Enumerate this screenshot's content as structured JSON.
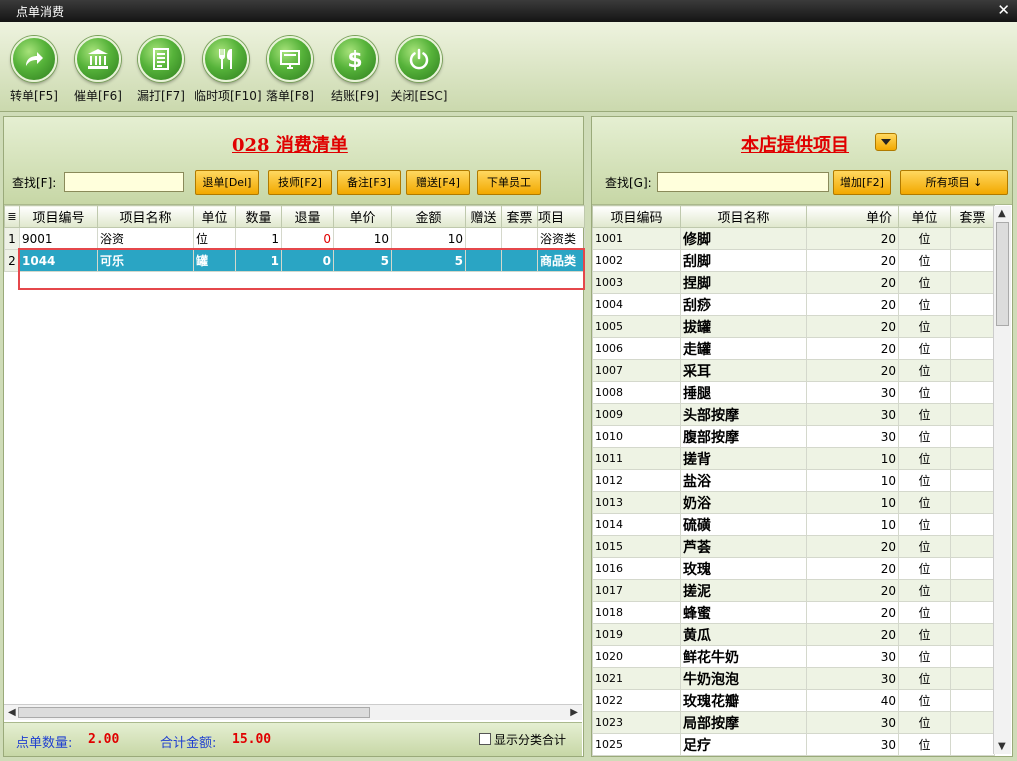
{
  "window": {
    "title": "点单消费",
    "close_glyph": "✕"
  },
  "toolbar": [
    {
      "name": "transfer",
      "label": "转单[F5]",
      "icon": "arrow-redo-icon"
    },
    {
      "name": "urge",
      "label": "催单[F6]",
      "icon": "bank-icon"
    },
    {
      "name": "reprint",
      "label": "漏打[F7]",
      "icon": "document-icon"
    },
    {
      "name": "temp-item",
      "label": "临时项[F10]",
      "icon": "utensils-icon"
    },
    {
      "name": "place-order",
      "label": "落单[F8]",
      "icon": "monitor-icon"
    },
    {
      "name": "checkout",
      "label": "结账[F9]",
      "icon": "dollar-icon"
    },
    {
      "name": "close",
      "label": "关闭[ESC]",
      "icon": "power-icon"
    }
  ],
  "left": {
    "title": "028 消费清单",
    "search_label": "查找[F]:",
    "search_value": "",
    "buttons": [
      "退单[Del]",
      "技师[F2]",
      "备注[F3]",
      "赠送[F4]",
      "下单员工"
    ],
    "columns": [
      "项目编号",
      "项目名称",
      "单位",
      "数量",
      "退量",
      "单价",
      "金额",
      "赠送",
      "套票",
      "项目"
    ],
    "rows": [
      {
        "idx": "1",
        "code": "9001",
        "name": "浴资",
        "unit": "位",
        "qty": "1",
        "ret": "0",
        "price": "10",
        "amount": "10",
        "gift": "",
        "ticket": "",
        "category": "浴资类"
      },
      {
        "idx": "2",
        "code": "1044",
        "name": "可乐",
        "unit": "罐",
        "qty": "1",
        "ret": "0",
        "price": "5",
        "amount": "5",
        "gift": "",
        "ticket": "",
        "category": "商品类"
      }
    ]
  },
  "footer": {
    "count_label": "点单数量:",
    "count_value": "2.00",
    "total_label": "合计金额:",
    "total_value": "15.00",
    "checkbox_label": "显示分类合计"
  },
  "right": {
    "title": "本店提供项目",
    "search_label": "查找[G]:",
    "search_value": "",
    "add_button": "增加[F2]",
    "all_button": "所有项目 ↓",
    "columns": [
      "项目编码",
      "项目名称",
      "单价",
      "单位",
      "套票"
    ],
    "rows": [
      {
        "code": "1001",
        "name": "修脚",
        "price": "20",
        "unit": "位",
        "ticket": ""
      },
      {
        "code": "1002",
        "name": "刮脚",
        "price": "20",
        "unit": "位",
        "ticket": ""
      },
      {
        "code": "1003",
        "name": "捏脚",
        "price": "20",
        "unit": "位",
        "ticket": ""
      },
      {
        "code": "1004",
        "name": "刮痧",
        "price": "20",
        "unit": "位",
        "ticket": ""
      },
      {
        "code": "1005",
        "name": "拔罐",
        "price": "20",
        "unit": "位",
        "ticket": ""
      },
      {
        "code": "1006",
        "name": "走罐",
        "price": "20",
        "unit": "位",
        "ticket": ""
      },
      {
        "code": "1007",
        "name": "采耳",
        "price": "20",
        "unit": "位",
        "ticket": ""
      },
      {
        "code": "1008",
        "name": "捶腿",
        "price": "30",
        "unit": "位",
        "ticket": ""
      },
      {
        "code": "1009",
        "name": "头部按摩",
        "price": "30",
        "unit": "位",
        "ticket": ""
      },
      {
        "code": "1010",
        "name": "腹部按摩",
        "price": "30",
        "unit": "位",
        "ticket": ""
      },
      {
        "code": "1011",
        "name": "搓背",
        "price": "10",
        "unit": "位",
        "ticket": ""
      },
      {
        "code": "1012",
        "name": "盐浴",
        "price": "10",
        "unit": "位",
        "ticket": ""
      },
      {
        "code": "1013",
        "name": "奶浴",
        "price": "10",
        "unit": "位",
        "ticket": ""
      },
      {
        "code": "1014",
        "name": "硫磺",
        "price": "10",
        "unit": "位",
        "ticket": ""
      },
      {
        "code": "1015",
        "name": "芦荟",
        "price": "20",
        "unit": "位",
        "ticket": ""
      },
      {
        "code": "1016",
        "name": "玫瑰",
        "price": "20",
        "unit": "位",
        "ticket": ""
      },
      {
        "code": "1017",
        "name": "搓泥",
        "price": "20",
        "unit": "位",
        "ticket": ""
      },
      {
        "code": "1018",
        "name": "蜂蜜",
        "price": "20",
        "unit": "位",
        "ticket": ""
      },
      {
        "code": "1019",
        "name": "黄瓜",
        "price": "20",
        "unit": "位",
        "ticket": ""
      },
      {
        "code": "1020",
        "name": "鲜花牛奶",
        "price": "30",
        "unit": "位",
        "ticket": ""
      },
      {
        "code": "1021",
        "name": "牛奶泡泡",
        "price": "30",
        "unit": "位",
        "ticket": ""
      },
      {
        "code": "1022",
        "name": "玫瑰花瓣",
        "price": "40",
        "unit": "位",
        "ticket": ""
      },
      {
        "code": "1023",
        "name": "局部按摩",
        "price": "30",
        "unit": "位",
        "ticket": ""
      },
      {
        "code": "1025",
        "name": "足疗",
        "price": "30",
        "unit": "位",
        "ticket": ""
      }
    ]
  }
}
